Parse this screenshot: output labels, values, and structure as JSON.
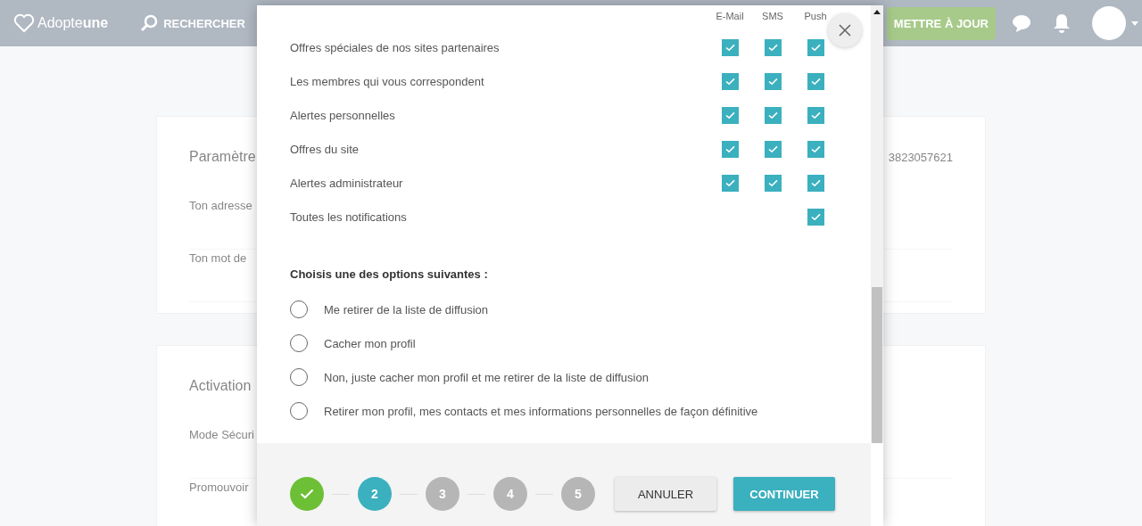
{
  "header": {
    "logo": "Adopte**une**",
    "search_label": "RECHERCHER",
    "upgrade_button": "METTRE À JOUR"
  },
  "background": {
    "cards": [
      {
        "title": "Paramètre",
        "fields": [
          "Ton adresse",
          "Ton mot de"
        ],
        "side_value": "3823057621"
      },
      {
        "title": "Activation",
        "fields": [
          "Mode Sécuri",
          "Promouvoir"
        ]
      }
    ]
  },
  "modal": {
    "columns": [
      "E-Mail",
      "SMS",
      "Push"
    ],
    "notifications": [
      {
        "label": "Offres spéciales de nos sites partenaires",
        "email": true,
        "sms": true,
        "push": true
      },
      {
        "label": "Les membres qui vous correspondent",
        "email": true,
        "sms": true,
        "push": true
      },
      {
        "label": "Alertes personnelles",
        "email": true,
        "sms": true,
        "push": true
      },
      {
        "label": "Offres du site",
        "email": true,
        "sms": true,
        "push": true
      },
      {
        "label": "Alertes administrateur",
        "email": true,
        "sms": true,
        "push": true
      },
      {
        "label": "Toutes les notifications",
        "push": true
      }
    ],
    "options_heading": "Choisis une des options suivantes :",
    "options": [
      {
        "label": "Me retirer de la liste de diffusion",
        "selected": false
      },
      {
        "label": "Cacher mon profil",
        "selected": false
      },
      {
        "label": "Non, juste cacher mon profil et me retirer de la liste de diffusion",
        "selected": false
      },
      {
        "label": "Retirer mon profil, mes contacts et mes informations personnelles de façon définitive",
        "selected": false
      }
    ],
    "steps": [
      {
        "kind": "done"
      },
      {
        "kind": "current",
        "label": "2"
      },
      {
        "kind": "todo",
        "label": "3"
      },
      {
        "kind": "todo",
        "label": "4"
      },
      {
        "kind": "todo",
        "label": "5"
      }
    ],
    "buttons": {
      "cancel": "ANNULER",
      "continue": "CONTINUER"
    }
  }
}
